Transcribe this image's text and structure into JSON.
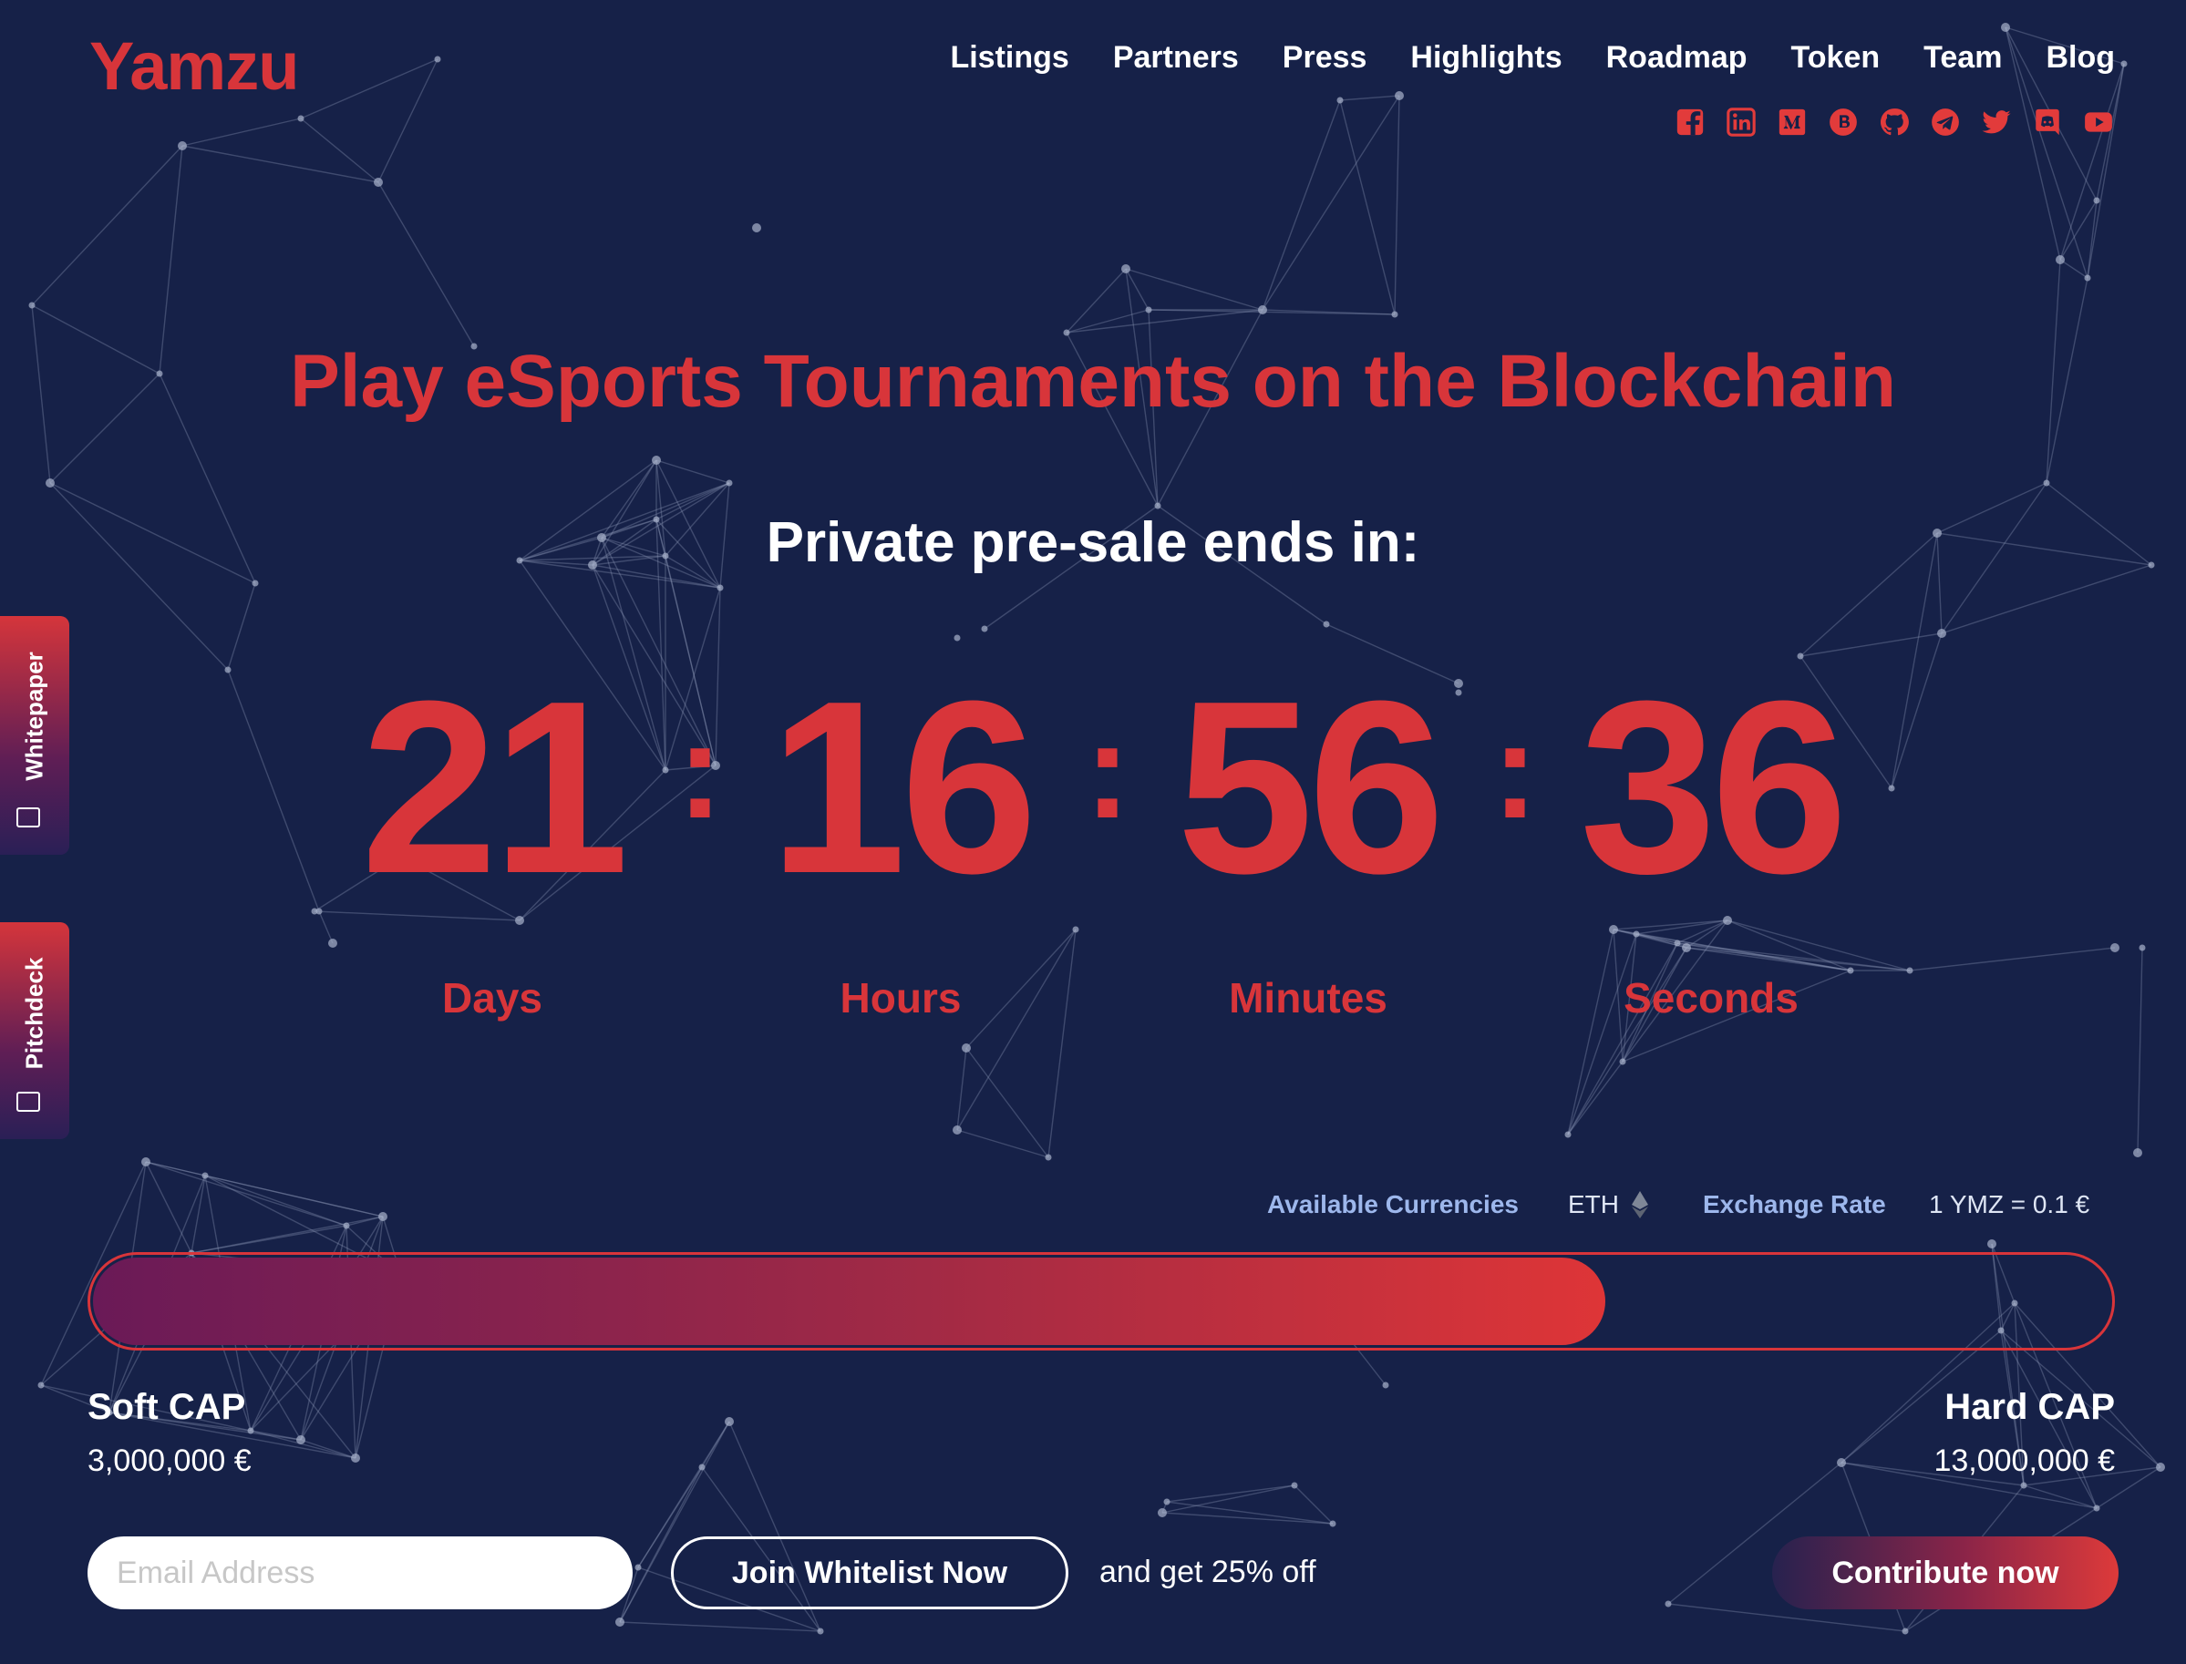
{
  "brand": {
    "logo": "Yamzu",
    "accent": "#d8353a",
    "background": "#162148"
  },
  "nav": {
    "items": [
      {
        "label": "Listings"
      },
      {
        "label": "Partners"
      },
      {
        "label": "Press"
      },
      {
        "label": "Highlights"
      },
      {
        "label": "Roadmap"
      },
      {
        "label": "Token"
      },
      {
        "label": "Team"
      },
      {
        "label": "Blog"
      }
    ]
  },
  "social": [
    "facebook-icon",
    "linkedin-icon",
    "medium-icon",
    "bitcointalk-icon",
    "github-icon",
    "telegram-icon",
    "twitter-icon",
    "discord-icon",
    "youtube-icon"
  ],
  "side_tabs": {
    "whitepaper": "Whitepaper",
    "pitchdeck": "Pitchdeck"
  },
  "hero": {
    "headline": "Play eSports Tournaments on the Blockchain",
    "countdown_title": "Private pre-sale ends in:"
  },
  "countdown": {
    "days": "21",
    "hours": "16",
    "minutes": "56",
    "seconds": "36",
    "separator": ":",
    "labels": {
      "days": "Days",
      "hours": "Hours",
      "minutes": "Minutes",
      "seconds": "Seconds"
    }
  },
  "sale": {
    "currencies_label": "Available Currencies",
    "currencies_value": "ETH",
    "rate_label": "Exchange Rate",
    "rate_value": "1 YMZ = 0.1 €",
    "progress_fraction": 0.75,
    "soft_cap_label": "Soft CAP",
    "soft_cap_value": "3,000,000 €",
    "hard_cap_label": "Hard CAP",
    "hard_cap_value": "13,000,000 €"
  },
  "signup": {
    "email_placeholder": "Email Address",
    "email_value": "",
    "join_label": "Join Whitelist Now",
    "discount_text": "and get 25% off",
    "contribute_label": "Contribute now"
  }
}
